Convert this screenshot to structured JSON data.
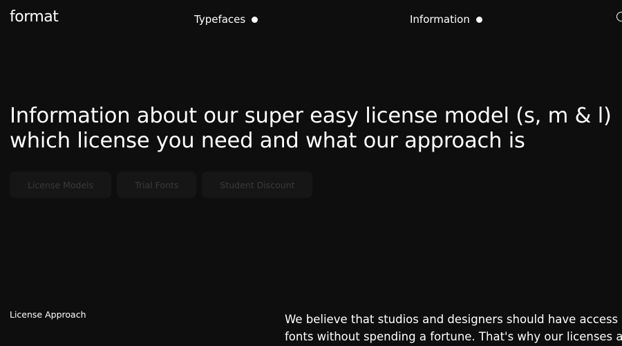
{
  "header": {
    "logo_text": "format",
    "nav": [
      {
        "label": "Typefaces",
        "icon": "dot-icon"
      },
      {
        "label": "Information",
        "icon": "dot-icon"
      }
    ],
    "partial_icon": "circle-icon"
  },
  "hero": {
    "headline_line1": "Information about our super easy license model (s, m & l)",
    "headline_line2": "which license you need and what our approach is"
  },
  "tabs": [
    {
      "label": "License Models"
    },
    {
      "label": "Trial Fonts"
    },
    {
      "label": "Student Discount"
    }
  ],
  "section": {
    "label": "License Approach",
    "body_line1": "We believe that studios and designers should have access",
    "body_line2": "fonts without spending a fortune. That's why our licenses a"
  },
  "colors": {
    "background": "#0e0e0e",
    "text": "#ffffff",
    "pill_background": "#161616",
    "pill_text": "#3a3a3a"
  }
}
